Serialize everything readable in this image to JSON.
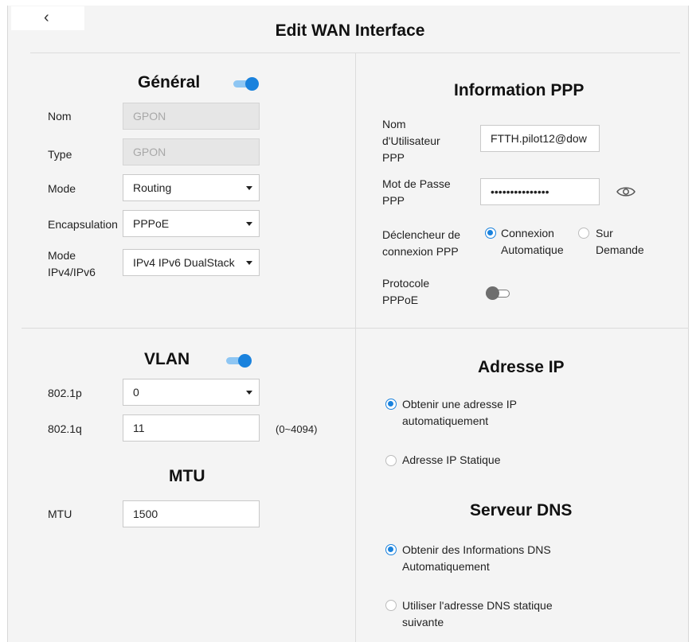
{
  "header": {
    "back_icon": "chevron-left-icon",
    "back_glyph": "‹",
    "title": "Edit WAN Interface"
  },
  "general": {
    "heading": "Général",
    "enabled": true,
    "nom_label": "Nom",
    "nom_value": "GPON",
    "type_label": "Type",
    "type_value": "GPON",
    "mode_label": "Mode",
    "mode_value": "Routing",
    "encap_label": "Encapsulation",
    "encap_value": "PPPoE",
    "ipmode_label_1": "Mode",
    "ipmode_label_2": "IPv4/IPv6",
    "ipmode_value": "IPv4 IPv6 DualStack"
  },
  "ppp": {
    "heading": "Information PPP",
    "user_label_1": "Nom",
    "user_label_2": "d'Utilisateur",
    "user_label_3": "PPP",
    "user_value": "FTTH.pilot12@dow",
    "pass_label_1": "Mot de Passe",
    "pass_label_2": "PPP",
    "pass_value": "•••••••••••••••",
    "trigger_label_1": "Déclencheur de",
    "trigger_label_2": "connexion PPP",
    "trigger_opt1_1": "Connexion",
    "trigger_opt1_2": "Automatique",
    "trigger_opt2_1": "Sur",
    "trigger_opt2_2": "Demande",
    "trigger_selected": "Connexion Automatique",
    "proto_label_1": "Protocole",
    "proto_label_2": "PPPoE",
    "proto_enabled": false
  },
  "vlan": {
    "heading": "VLAN",
    "enabled": true,
    "p_label": "802.1p",
    "p_value": "0",
    "q_label": "802.1q",
    "q_value": "11",
    "q_range": "(0~4094)"
  },
  "mtu": {
    "heading": "MTU",
    "label": "MTU",
    "value": "1500"
  },
  "ip": {
    "heading": "Adresse IP",
    "opt1_1": "Obtenir une adresse IP",
    "opt1_2": "automatiquement",
    "opt2": "Adresse IP Statique",
    "selected": "Obtenir une adresse IP automatiquement"
  },
  "dns": {
    "heading": "Serveur DNS",
    "opt1_1": "Obtenir des Informations DNS",
    "opt1_2": "Automatiquement",
    "opt2_1": "Utiliser l'adresse DNS statique",
    "opt2_2": "suivante",
    "selected": "Obtenir des Informations DNS Automatiquement"
  },
  "colors": {
    "accent": "#1a82dd",
    "toggle_track_on": "#8ec6f3",
    "background": "#f4f4f4"
  }
}
